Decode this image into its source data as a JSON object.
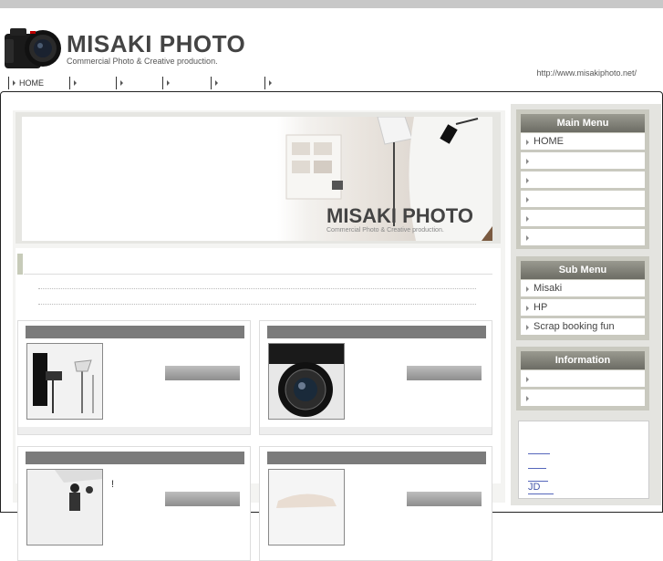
{
  "header": {
    "title": "MISAKI PHOTO",
    "subtitle": "Commercial Photo & Creative production.",
    "url": "http://www.misakiphoto.net/"
  },
  "gnav": {
    "items": [
      "HOME",
      "",
      "",
      "",
      "",
      ""
    ]
  },
  "hero": {
    "title": "MISAKI PHOTO",
    "subtitle": "Commercial Photo & Creative production."
  },
  "cards": [
    {
      "thumb": "studio-lights-photo"
    },
    {
      "thumb": "camera-lens-photo"
    },
    {
      "thumb": "studio-people-photo",
      "note": "!"
    },
    {
      "thumb": "handshake-photo"
    }
  ],
  "sidebar": {
    "main_menu": {
      "title": "Main Menu",
      "items": [
        "HOME",
        "",
        "",
        "",
        "",
        ""
      ]
    },
    "sub_menu": {
      "title": "Sub Menu",
      "items": [
        "Misaki",
        "HP",
        "Scrap booking fun"
      ]
    },
    "information": {
      "title": "Information",
      "items": [
        "",
        ""
      ]
    },
    "bottom_text": "JD"
  },
  "colors": {
    "accent": "#c7cbb9",
    "menu_head": "#7b7b72",
    "card_bar": "#7b7b7b",
    "link": "#4455aa"
  }
}
